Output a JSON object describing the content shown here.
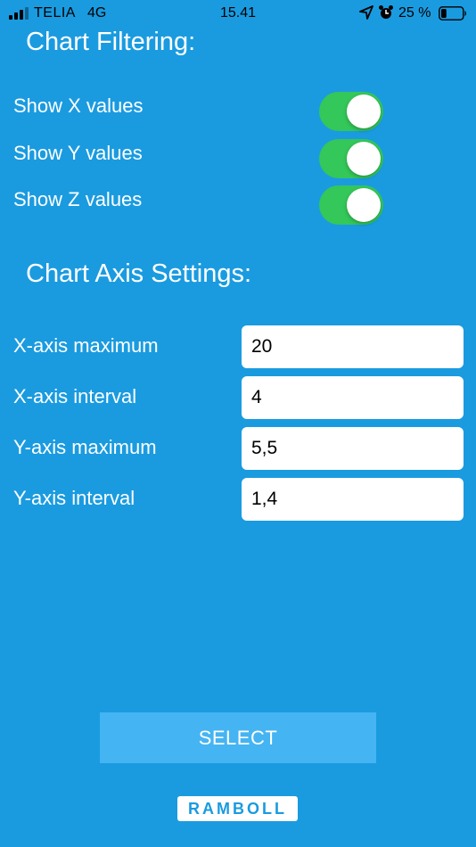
{
  "status_bar": {
    "carrier": "TELIA",
    "network": "4G",
    "time": "15.41",
    "battery_percent": "25 %",
    "battery_level": 0.25
  },
  "filtering": {
    "heading": "Chart Filtering:",
    "toggles": [
      {
        "label": "Show X values",
        "on": true
      },
      {
        "label": "Show Y values",
        "on": true
      },
      {
        "label": "Show Z values",
        "on": true
      }
    ]
  },
  "axis_settings": {
    "heading": "Chart Axis Settings:",
    "fields": [
      {
        "label": "X-axis maximum",
        "value": "20"
      },
      {
        "label": "X-axis interval",
        "value": "4"
      },
      {
        "label": "Y-axis maximum",
        "value": "5,5"
      },
      {
        "label": "Y-axis interval",
        "value": "1,4"
      }
    ]
  },
  "select_label": "SELECT",
  "logo_text": "RAMBOLL",
  "colors": {
    "background": "#1a9be0",
    "toggle_on": "#34c759",
    "button": "#45b4f2"
  }
}
